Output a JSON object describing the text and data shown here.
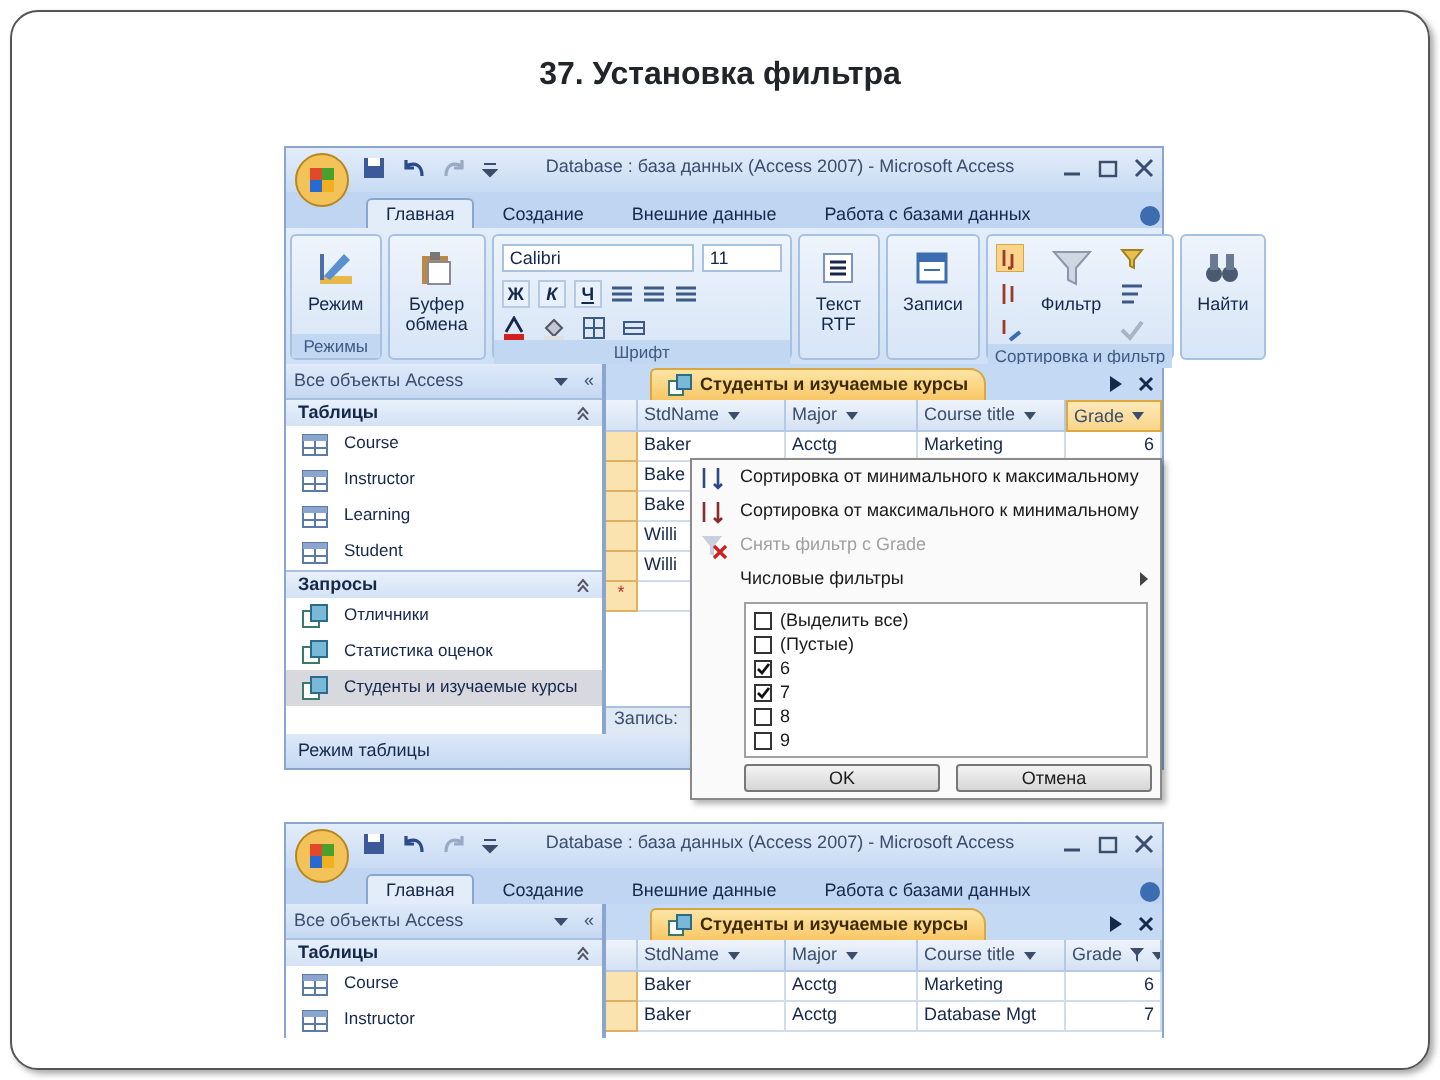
{
  "slide_title": "37. Установка фильтра",
  "screens": [
    {
      "window": {
        "title": "Database : база данных (Access 2007) - Microsoft Access"
      },
      "ribbon_tabs": [
        {
          "label": "Главная",
          "selected": true
        },
        {
          "label": "Создание",
          "selected": false
        },
        {
          "label": "Внешние данные",
          "selected": false
        },
        {
          "label": "Работа с базами данных",
          "selected": false
        }
      ],
      "ribbon": {
        "groups": [
          {
            "kind": "large",
            "label": "Режимы",
            "buttons": [
              {
                "label": "Режим",
                "kind": "view"
              }
            ]
          },
          {
            "kind": "large",
            "buttons": [
              {
                "label": "Буфер обмена",
                "kind": "clipboard"
              }
            ]
          },
          {
            "kind": "font",
            "label": "Шрифт",
            "font_name": "Calibri",
            "font_size": "11",
            "format_buttons": [
              "Ж",
              "К",
              "Ч"
            ]
          },
          {
            "kind": "large",
            "buttons": [
              {
                "label": "Текст RTF",
                "kind": "rtf"
              }
            ]
          },
          {
            "kind": "large",
            "buttons": [
              {
                "label": "Записи",
                "kind": "records"
              }
            ]
          },
          {
            "kind": "sort",
            "label": "Сортировка и фильтр",
            "buttons": [
              {
                "label": "Фильтр",
                "kind": "filter"
              }
            ]
          },
          {
            "kind": "large",
            "buttons": [
              {
                "label": "Найти",
                "kind": "find"
              }
            ]
          }
        ]
      },
      "nav_pane": {
        "header": "Все объекты Access",
        "collapse": "«",
        "sections": [
          {
            "title": "Таблицы",
            "kind": "tables",
            "items": [
              {
                "label": "Course",
                "selected": false
              },
              {
                "label": "Instructor",
                "selected": false
              },
              {
                "label": "Learning",
                "selected": false
              },
              {
                "label": "Student",
                "selected": false
              }
            ]
          },
          {
            "title": "Запросы",
            "kind": "queries",
            "items": [
              {
                "label": "Отличники",
                "selected": false
              },
              {
                "label": "Статистика оценок",
                "selected": false
              },
              {
                "label": "Студенты и изучаемые курсы",
                "selected": true
              }
            ]
          }
        ]
      },
      "document_tab": {
        "title": "Студенты и изучаемые курсы"
      },
      "table": {
        "columns": [
          {
            "label": "StdName",
            "selected": false
          },
          {
            "label": "Major",
            "selected": false
          },
          {
            "label": "Course title",
            "selected": false
          },
          {
            "label": "Grade",
            "selected": true
          }
        ],
        "rows": [
          [
            "Baker",
            "Acctg",
            "Marketing",
            "6"
          ],
          [
            "Bake"
          ],
          [
            "Bake"
          ],
          [
            "Willi"
          ],
          [
            "Willi"
          ]
        ],
        "new_row_marker": "*"
      },
      "record_nav": "Запись:",
      "status_bar": "Режим таблицы",
      "filter_menu": {
        "items": [
          {
            "kind": "sort_asc",
            "label": "Сортировка от минимального к максимальному",
            "disabled": false
          },
          {
            "kind": "sort_desc",
            "label": "Сортировка от максимального к минимальному",
            "disabled": false
          },
          {
            "kind": "clear_filter",
            "label": "Снять фильтр с Grade",
            "disabled": true
          },
          {
            "kind": "submenu",
            "label": "Числовые фильтры",
            "disabled": false
          }
        ],
        "values": [
          {
            "label": "(Выделить все)",
            "checked": false
          },
          {
            "label": "(Пустые)",
            "checked": false
          },
          {
            "label": "6",
            "checked": true
          },
          {
            "label": "7",
            "checked": true
          },
          {
            "label": "8",
            "checked": false
          },
          {
            "label": "9",
            "checked": false
          }
        ],
        "buttons": [
          "OK",
          "Отмена"
        ]
      }
    },
    {
      "window": {
        "title": "Database : база данных (Access 2007) - Microsoft Access"
      },
      "ribbon_tabs": [
        {
          "label": "Главная",
          "selected": true
        },
        {
          "label": "Создание",
          "selected": false
        },
        {
          "label": "Внешние данные",
          "selected": false
        },
        {
          "label": "Работа с базами данных",
          "selected": false
        }
      ],
      "nav_pane": {
        "header": "Все объекты Access",
        "collapse": "«",
        "sections": [
          {
            "title": "Таблицы",
            "kind": "tables",
            "items": [
              {
                "label": "Course",
                "selected": false
              },
              {
                "label": "Instructor",
                "selected": false
              }
            ]
          }
        ]
      },
      "document_tab": {
        "title": "Студенты и изучаемые курсы"
      },
      "table": {
        "columns": [
          {
            "label": "StdName",
            "selected": false
          },
          {
            "label": "Major",
            "selected": false
          },
          {
            "label": "Course title",
            "selected": false
          },
          {
            "label": "Grade",
            "selected": false,
            "filtered": true
          }
        ],
        "rows": [
          [
            "Baker",
            "Acctg",
            "Marketing",
            "6"
          ],
          [
            "Baker",
            "Acctg",
            "Database Mgt",
            "7"
          ]
        ]
      }
    }
  ]
}
